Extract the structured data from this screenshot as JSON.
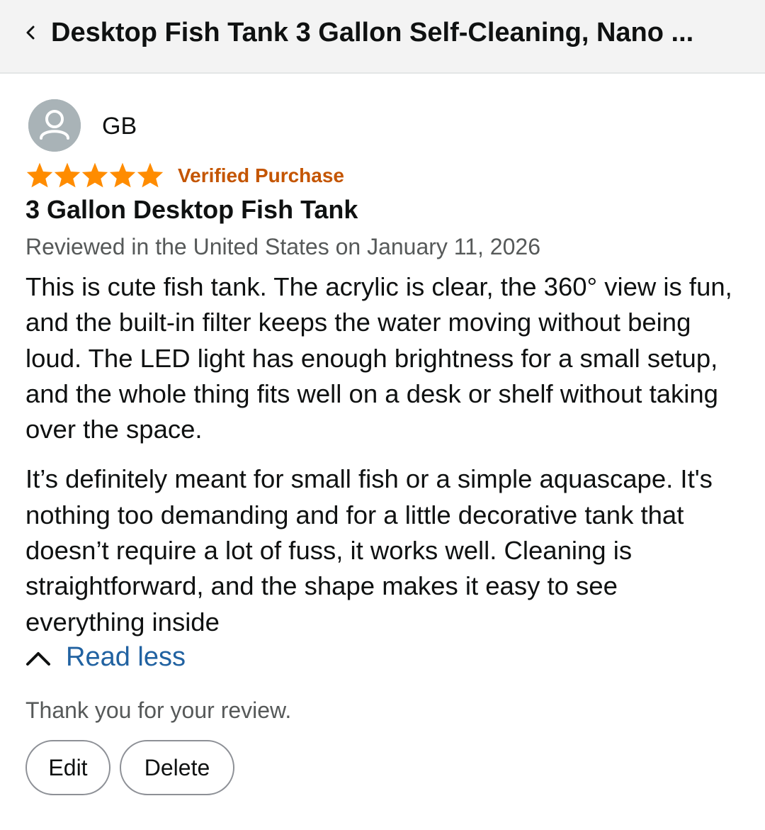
{
  "header": {
    "back_icon": "chevron-left-icon",
    "title": "Desktop Fish Tank 3 Gallon Self-Cleaning, Nano ..."
  },
  "review": {
    "reviewer_name": "GB",
    "avatar_icon": "user-avatar-icon",
    "rating": 5,
    "rating_max": 5,
    "star_color": "#ff8c00",
    "verified_label": "Verified Purchase",
    "verified_color": "#c45500",
    "title": "3 Gallon Desktop Fish Tank",
    "meta": "Reviewed in the United States on January 11, 2026",
    "paragraphs": [
      "This is cute fish tank. The acrylic is clear, the 360° view is fun, and the built-in filter keeps the water moving without being loud. The LED light has enough brightness for a small setup, and the whole thing fits well on a desk or shelf without taking over the space.",
      "It’s definitely meant for small fish or a simple aquascape. It's nothing too demanding and for a little decorative tank that doesn’t require a lot of fuss, it works well. Cleaning is straightforward, and the shape makes it easy to see everything inside"
    ],
    "read_less_icon": "chevron-up-icon",
    "read_less_label": "Read less",
    "link_color": "#2162a1"
  },
  "footer": {
    "thanks": "Thank you for your review.",
    "edit_label": "Edit",
    "delete_label": "Delete"
  }
}
